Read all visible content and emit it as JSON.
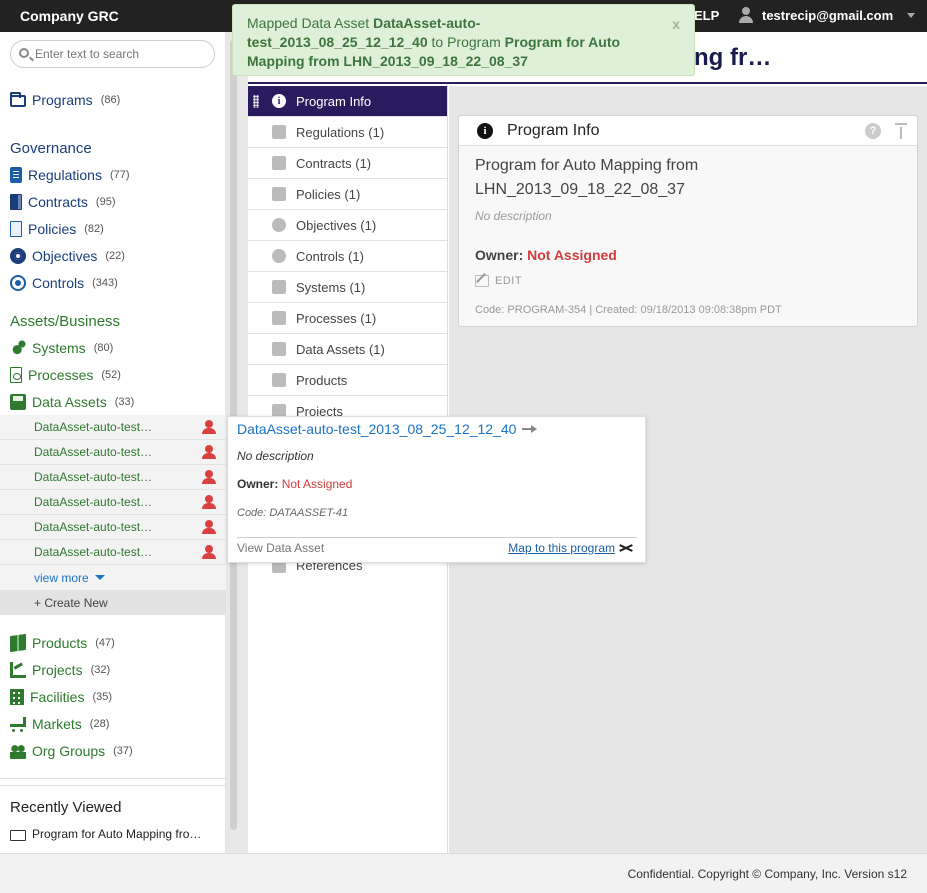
{
  "header": {
    "app_title": "Company GRC",
    "help_label": "ELP",
    "user_email": "testrecip@gmail.com"
  },
  "notification": {
    "prefix": "Mapped Data Asset ",
    "asset": "DataAsset-auto-test_2013_08_25_12_12_40",
    "middle": " to Program ",
    "program": "Program for Auto Mapping from LHN_2013_09_18_22_08_37",
    "close": "x"
  },
  "page_title": "ng fr…",
  "sidebar": {
    "search_placeholder": "Enter text to search",
    "programs": {
      "label": "Programs",
      "count": "(86)"
    },
    "governance": {
      "heading": "Governance",
      "items": [
        {
          "label": "Regulations",
          "count": "(77)"
        },
        {
          "label": "Contracts",
          "count": "(95)"
        },
        {
          "label": "Policies",
          "count": "(82)"
        },
        {
          "label": "Objectives",
          "count": "(22)"
        },
        {
          "label": "Controls",
          "count": "(343)"
        }
      ]
    },
    "assets": {
      "heading": "Assets/Business",
      "items": [
        {
          "label": "Systems",
          "count": "(80)"
        },
        {
          "label": "Processes",
          "count": "(52)"
        },
        {
          "label": "Data Assets",
          "count": "(33)"
        }
      ]
    },
    "data_asset_list": [
      "DataAsset-auto-test…",
      "DataAsset-auto-test…",
      "DataAsset-auto-test…",
      "DataAsset-auto-test…",
      "DataAsset-auto-test…",
      "DataAsset-auto-test…"
    ],
    "view_more": "view more",
    "create_new": "+ Create New",
    "more_items": [
      {
        "label": "Products",
        "count": "(47)"
      },
      {
        "label": "Projects",
        "count": "(32)"
      },
      {
        "label": "Facilities",
        "count": "(35)"
      },
      {
        "label": "Markets",
        "count": "(28)"
      },
      {
        "label": "Org Groups",
        "count": "(37)"
      }
    ],
    "recently_viewed": {
      "heading": "Recently Viewed",
      "item": "Program for Auto Mapping fro…"
    }
  },
  "inner_nav": {
    "active": "Program Info",
    "items": [
      "Regulations (1)",
      "Contracts (1)",
      "Policies (1)",
      "Objectives (1)",
      "Controls (1)",
      "Systems (1)",
      "Processes (1)",
      "Data Assets (1)",
      "Products",
      "Projects"
    ],
    "hidden_tail": "References"
  },
  "program_card": {
    "title": "Program Info",
    "name": "Program for Auto Mapping from LHN_2013_09_18_22_08_37",
    "description": "No description",
    "owner_label": "Owner:",
    "owner_value": "Not Assigned",
    "edit": "EDIT",
    "code_line": "Code: PROGRAM-354 | Created: 09/18/2013 09:08:38pm PDT"
  },
  "popover": {
    "title": "DataAsset-auto-test_2013_08_25_12_12_40",
    "description": "No description",
    "owner_label": "Owner:",
    "owner_value": "Not Assigned",
    "code": "Code: DATAASSET-41",
    "view_link": "View Data Asset",
    "map_link": "Map to this program"
  },
  "footer": {
    "text": "Confidential. Copyright © Company, Inc. Version s12"
  },
  "colors": {
    "nav_active": "#2a1a5e",
    "governance_blue": "#1a3d7c",
    "business_green": "#2f7a2f",
    "alert_red": "#d23c3c",
    "notice_bg": "#dff0d8"
  }
}
